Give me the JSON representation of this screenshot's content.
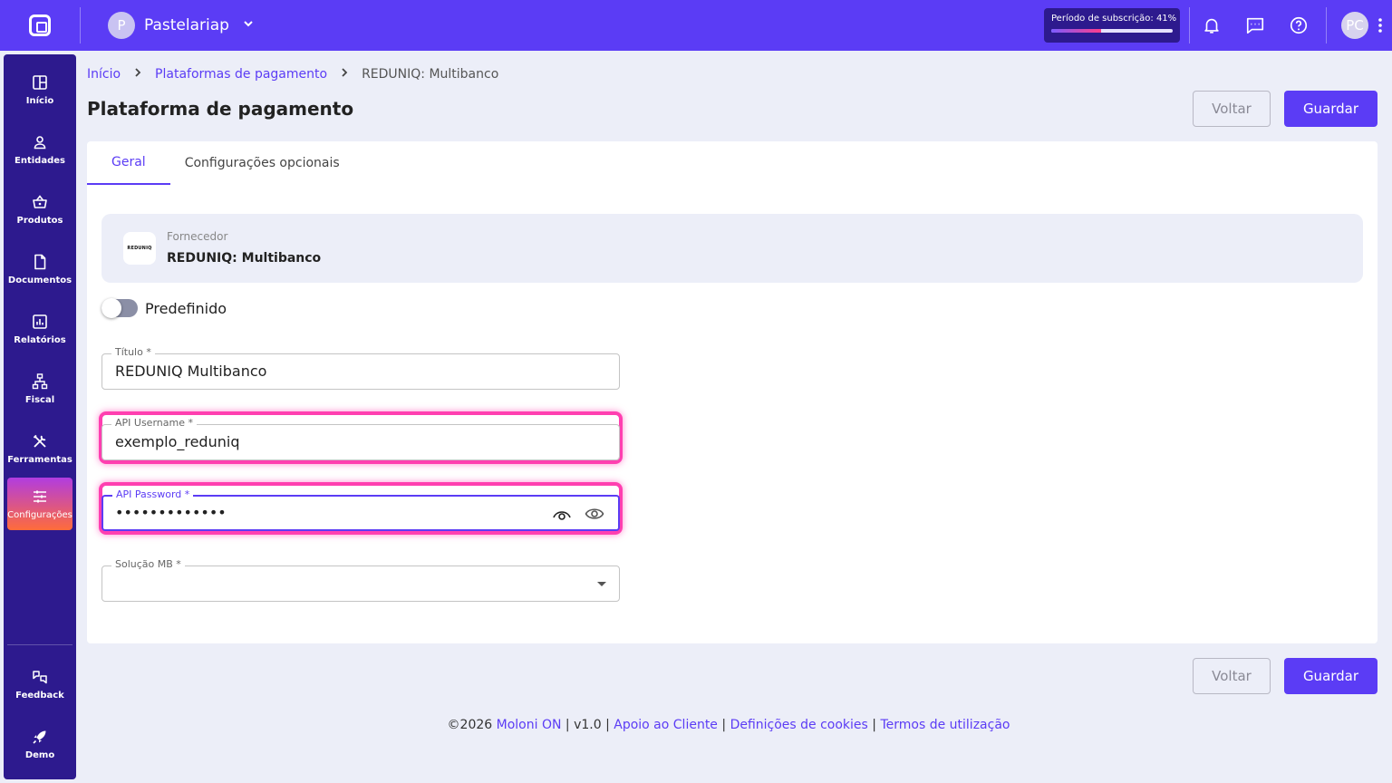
{
  "topbar": {
    "company_initial": "P",
    "company_name": "Pastelariap",
    "subscription_label": "Período de subscrição: 41%",
    "subscription_progress": 0.41,
    "user_initials": "PC"
  },
  "sidebar": {
    "items": [
      {
        "label": "Início",
        "icon": "dashboard-icon"
      },
      {
        "label": "Entidades",
        "icon": "user-icon"
      },
      {
        "label": "Produtos",
        "icon": "basket-icon"
      },
      {
        "label": "Documentos",
        "icon": "document-icon"
      },
      {
        "label": "Relatórios",
        "icon": "chart-icon"
      },
      {
        "label": "Fiscal",
        "icon": "hierarchy-icon"
      },
      {
        "label": "Ferramentas",
        "icon": "tools-icon"
      },
      {
        "label": "Configurações",
        "icon": "sliders-icon"
      }
    ],
    "bottom": [
      {
        "label": "Feedback",
        "icon": "feedback-icon"
      },
      {
        "label": "Demo",
        "icon": "rocket-icon"
      }
    ]
  },
  "breadcrumb": {
    "home": "Início",
    "parent": "Plataformas de pagamento",
    "current": "REDUNIQ: Multibanco"
  },
  "page": {
    "title": "Plataforma de pagamento",
    "back_label": "Voltar",
    "save_label": "Guardar"
  },
  "tabs": [
    {
      "label": "Geral",
      "active": true
    },
    {
      "label": "Configurações opcionais",
      "active": false
    }
  ],
  "provider": {
    "label": "Fornecedor",
    "name": "REDUNIQ: Multibanco",
    "logo_text": "REDUNIQ"
  },
  "form": {
    "default_toggle_label": "Predefinido",
    "title_label": "Título *",
    "title_value": "REDUNIQ Multibanco",
    "username_label": "API Username *",
    "username_value": "exemplo_reduniq",
    "password_label": "API Password *",
    "password_value": "•••••••••••••",
    "solution_label": "Solução MB *",
    "solution_value": ""
  },
  "footer": {
    "copyright": "©2026",
    "brand": "Moloni ON",
    "version": "v1.0",
    "support": "Apoio ao Cliente",
    "cookies": "Definições de cookies",
    "terms": "Termos de utilização"
  },
  "colors": {
    "brand": "#5b3cf5",
    "sidebar": "#2d1a8e",
    "highlight": "#ff3fb0"
  }
}
